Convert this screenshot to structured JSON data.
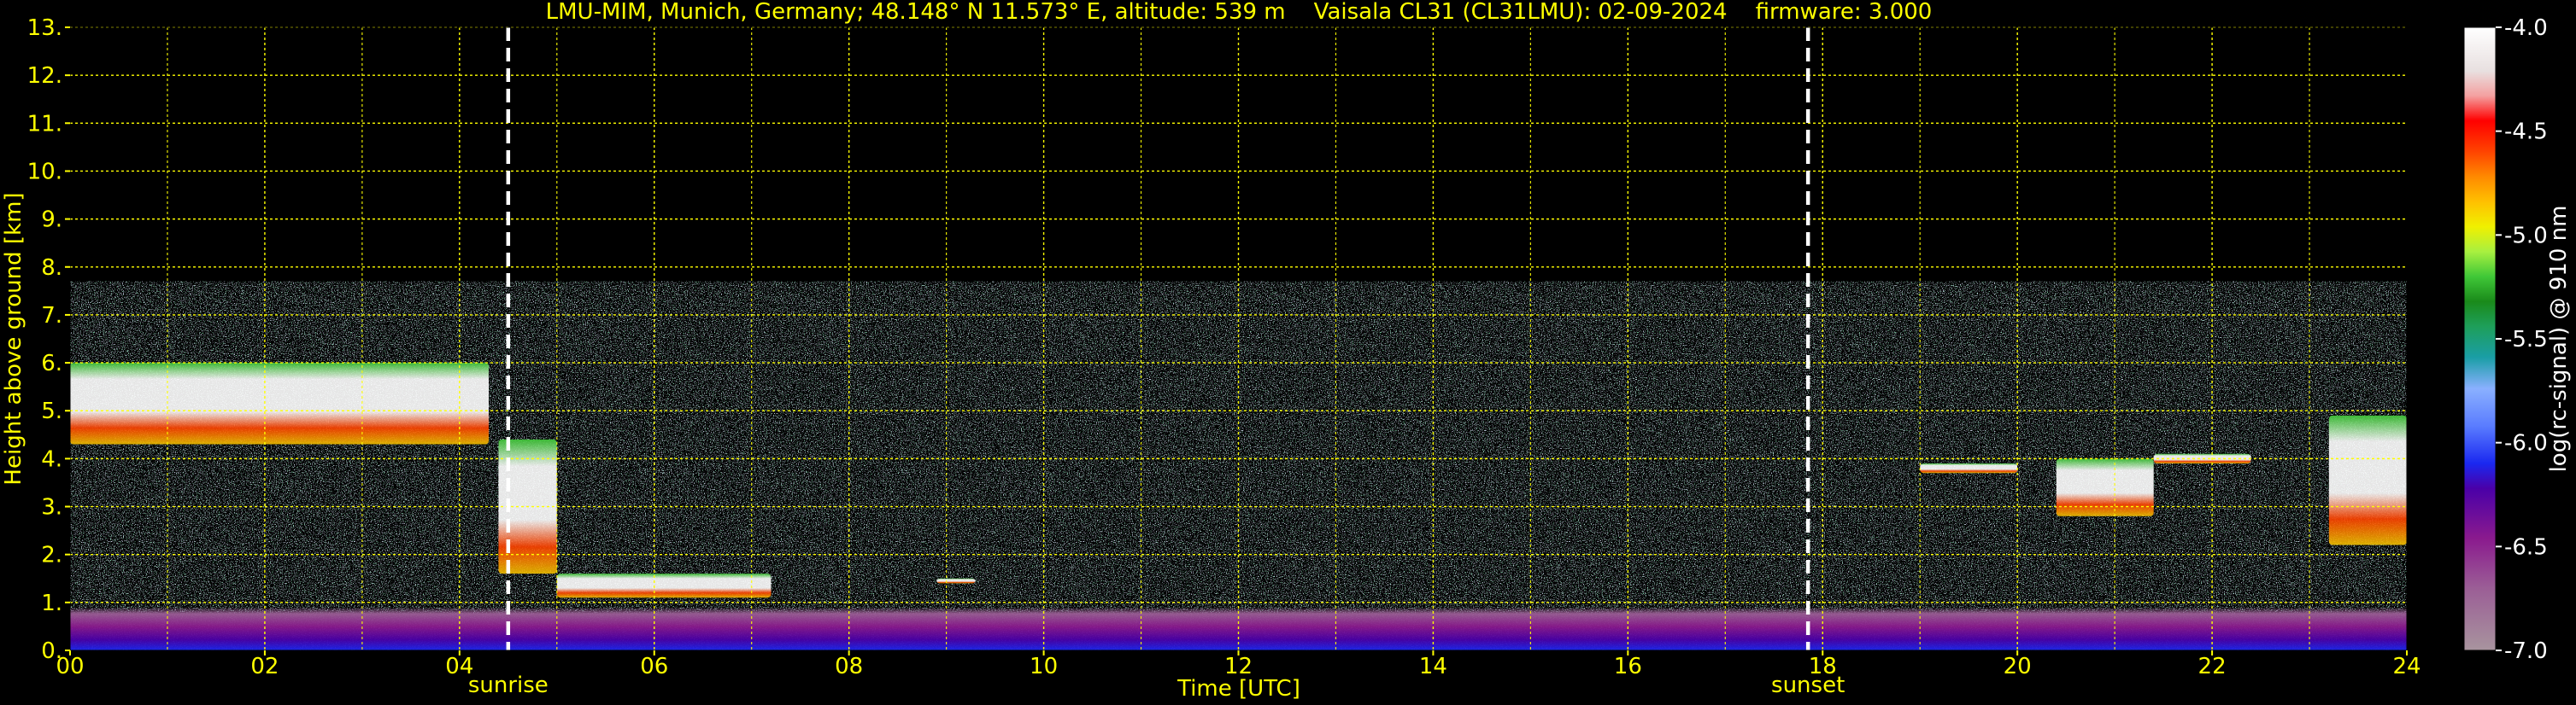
{
  "chart_data": {
    "type": "heatmap",
    "title": "LMU-MIM, Munich, Germany; 48.148° N 11.573° E, altitude: 539 m    Vaisala CL31 (CL31LMU): 02-09-2024    firmware: 3.000",
    "xlabel": "Time [UTC]",
    "ylabel": "Height above ground [km]",
    "xlim": [
      0,
      24
    ],
    "ylim": [
      0,
      13
    ],
    "x_ticks": [
      0,
      2,
      4,
      6,
      8,
      10,
      12,
      14,
      16,
      18,
      20,
      22,
      24
    ],
    "x_tick_labels": [
      "00",
      "02",
      "04",
      "06",
      "08",
      "10",
      "12",
      "14",
      "16",
      "18",
      "20",
      "22",
      "24"
    ],
    "y_ticks": [
      0,
      1,
      2,
      3,
      4,
      5,
      6,
      7,
      8,
      9,
      10,
      11,
      12,
      13
    ],
    "y_tick_labels": [
      "0.",
      "1.",
      "2.",
      "3.",
      "4.",
      "5.",
      "6.",
      "7.",
      "8.",
      "9.",
      "10.",
      "11.",
      "12.",
      "13."
    ],
    "grid": true,
    "grid_color": "#ffff00",
    "signal_top_km": 7.7,
    "events": [
      {
        "label": "sunrise",
        "time_h": 4.5
      },
      {
        "label": "sunset",
        "time_h": 17.85
      }
    ],
    "colorbar": {
      "label": "log(rc-signal) @ 910 nm",
      "range": [
        -7.0,
        -4.0
      ],
      "ticks": [
        -7.0,
        -6.5,
        -6.0,
        -5.5,
        -5.0,
        -4.5,
        -4.0
      ],
      "tick_labels": [
        "-7.0",
        "-6.5",
        "-6.0",
        "-5.5",
        "-5.0",
        "-4.5",
        "-4.0"
      ]
    },
    "features": [
      {
        "name": "cloud layer",
        "t_start": 0.0,
        "t_end": 4.3,
        "h_low": 4.3,
        "h_high": 6.0,
        "intensity": -4.3
      },
      {
        "name": "cloud base",
        "t_start": 4.4,
        "t_end": 5.0,
        "h_low": 1.6,
        "h_high": 4.4,
        "intensity": -4.8
      },
      {
        "name": "low cloud",
        "t_start": 5.0,
        "t_end": 7.2,
        "h_low": 1.1,
        "h_high": 1.6,
        "intensity": -4.8
      },
      {
        "name": "cloud",
        "t_start": 8.9,
        "t_end": 9.3,
        "h_low": 1.4,
        "h_high": 1.5,
        "intensity": -4.5
      },
      {
        "name": "cloud",
        "t_start": 19.0,
        "t_end": 20.0,
        "h_low": 3.7,
        "h_high": 3.9,
        "intensity": -4.4
      },
      {
        "name": "cloud",
        "t_start": 20.4,
        "t_end": 21.4,
        "h_low": 2.8,
        "h_high": 4.0,
        "intensity": -4.5
      },
      {
        "name": "cloud",
        "t_start": 21.4,
        "t_end": 22.4,
        "h_low": 3.9,
        "h_high": 4.1,
        "intensity": -4.5
      },
      {
        "name": "cloud layer",
        "t_start": 23.2,
        "t_end": 24.0,
        "h_low": 2.2,
        "h_high": 4.9,
        "intensity": -4.4
      },
      {
        "name": "aerosol layer",
        "t_start": 0.0,
        "t_end": 24.0,
        "h_low": 0.0,
        "h_high": 0.9,
        "intensity": -6.2
      }
    ]
  }
}
